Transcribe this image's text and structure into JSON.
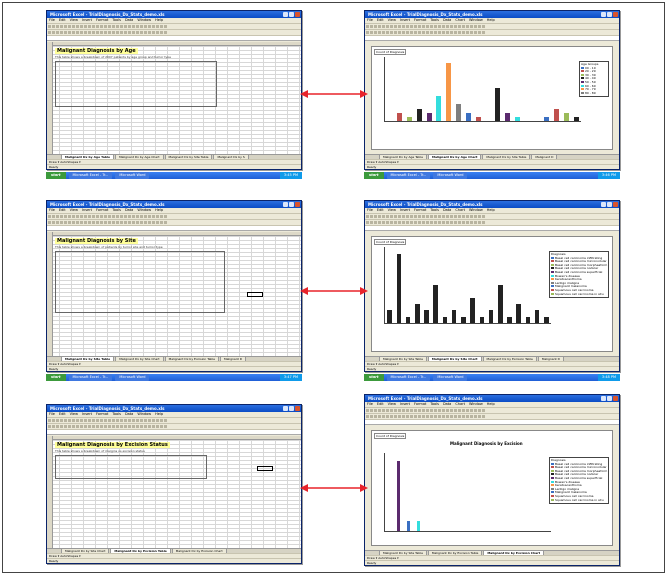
{
  "windows": [
    {
      "id": "age-table",
      "title": "Microsoft Excel - TrialDiagnosis_Dx_Stats_demo.xls",
      "menu": [
        "File",
        "Edit",
        "View",
        "Insert",
        "Format",
        "Tools",
        "Data",
        "Window",
        "Help"
      ],
      "sheet_title": "Malignant Diagnosis by Age",
      "sheet_subtitle": "This table shows a breakdown of 2007 patients by age group and tumor type",
      "tabs": [
        "Malignant Dx by Age Table",
        "Malignant Dx by Age Chart",
        "Malignant Dx by Site Table",
        "Malignant Dx by S"
      ],
      "active_tab": 0,
      "drawbar": "Draw ▾  AutoShapes ▾",
      "status": "Ready",
      "taskbar": {
        "start": "start",
        "tasks": [
          "Microsoft Excel - Tr...",
          "Microsoft Word"
        ],
        "clock": "3:45 PM"
      }
    },
    {
      "id": "age-chart",
      "title": "Microsoft Excel - TrialDiagnosis_Dx_Stats_demo.xls",
      "menu": [
        "File",
        "Edit",
        "View",
        "Insert",
        "Format",
        "Tools",
        "Data",
        "Chart",
        "Window",
        "Help"
      ],
      "chart_tag": "Count of Diagnosis",
      "legend_title": "Age Groups",
      "legend_items": [
        "00 - 19",
        "20 - 29",
        "30 - 39",
        "40 - 49",
        "50 - 59",
        "60 - 69",
        "70 - 79",
        "80 - 89"
      ],
      "tabs": [
        "Malignant Dx by Age Table",
        "Malignant Dx by Age Chart",
        "Malignant Dx by Site Table",
        "Malignant D"
      ],
      "active_tab": 1,
      "drawbar": "Draw ▾  AutoShapes ▾",
      "status": "Ready",
      "taskbar": {
        "start": "start",
        "tasks": [
          "Microsoft Excel - Tr...",
          "Microsoft Word"
        ],
        "clock": "3:46 PM"
      }
    },
    {
      "id": "site-table",
      "title": "Microsoft Excel - TrialDiagnosis_Dx_Stats_demo.xls",
      "menu": [
        "File",
        "Edit",
        "View",
        "Insert",
        "Format",
        "Tools",
        "Data",
        "Window",
        "Help"
      ],
      "sheet_title": "Malignant Diagnosis by Site",
      "sheet_subtitle": "This table shows a breakdown of patients by tumor site and tumor type",
      "tabs": [
        "Malignant Dx by Site Table",
        "Malignant Dx by Site Chart",
        "Malignant Dx by Excision Table",
        "Malignant D"
      ],
      "active_tab": 0,
      "drawbar": "Draw ▾  AutoShapes ▾",
      "status": "Ready",
      "taskbar": {
        "start": "start",
        "tasks": [
          "Microsoft Excel - Tr...",
          "Microsoft Word"
        ],
        "clock": "3:47 PM"
      }
    },
    {
      "id": "site-chart",
      "title": "Microsoft Excel - TrialDiagnosis_Dx_Stats_demo.xls",
      "menu": [
        "File",
        "Edit",
        "View",
        "Insert",
        "Format",
        "Tools",
        "Data",
        "Chart",
        "Window",
        "Help"
      ],
      "chart_tag": "Count of Diagnosis",
      "legend_title": "Diagnosis",
      "legend_items": [
        "Basal cell carcinoma infiltrating",
        "Basal cell carcinoma micronodular",
        "Basal cell carcinoma morpheaform",
        "Basal cell carcinoma nodular",
        "Basal cell carcinoma superficial",
        "Bowen's disease",
        "Keratoacanthoma",
        "Lentigo maligna",
        "Malignant melanoma",
        "Squamous cell carcinoma",
        "Squamous cell carcinoma in situ"
      ],
      "tabs": [
        "Malignant Dx by Site Table",
        "Malignant Dx by Site Chart",
        "Malignant Dx by Excision Table",
        "Malignant D"
      ],
      "active_tab": 1,
      "drawbar": "Draw ▾  AutoShapes ▾",
      "status": "Ready",
      "taskbar": {
        "start": "start",
        "tasks": [
          "Microsoft Excel - Tr...",
          "Microsoft Word"
        ],
        "clock": "3:48 PM"
      }
    },
    {
      "id": "excision-table",
      "title": "Microsoft Excel - TrialDiagnosis_Dx_Stats_demo.xls",
      "menu": [
        "File",
        "Edit",
        "View",
        "Insert",
        "Format",
        "Tools",
        "Data",
        "Window",
        "Help"
      ],
      "sheet_title": "Malignant Diagnosis by Excision Status",
      "sheet_subtitle": "This table shows a breakdown of margins vs excision status",
      "tabs": [
        "Malignant Dx by Site Chart",
        "Malignant Dx by Excision Table",
        "Malignant Dx by Excision Chart"
      ],
      "active_tab": 1,
      "drawbar": "Draw ▾  AutoShapes ▾",
      "status": "Ready",
      "taskbar": null
    },
    {
      "id": "excision-chart",
      "title": "Microsoft Excel - TrialDiagnosis_Dx_Stats_demo.xls",
      "menu": [
        "File",
        "Edit",
        "View",
        "Insert",
        "Format",
        "Tools",
        "Data",
        "Chart",
        "Window",
        "Help"
      ],
      "chart_title": "Malignant Diagnosis by Excision",
      "chart_tag": "Count of Diagnosis",
      "legend_title": "Diagnosis",
      "legend_items": [
        "Basal cell carcinoma infiltrating",
        "Basal cell carcinoma micronodular",
        "Basal cell carcinoma morpheaform",
        "Basal cell carcinoma nodular",
        "Basal cell carcinoma superficial",
        "Bowen's disease",
        "Keratoacanthoma",
        "Lentigo maligna",
        "Malignant melanoma",
        "Squamous cell carcinoma",
        "Squamous cell carcinoma in situ"
      ],
      "tabs": [
        "Malignant Dx by Site Table",
        "Malignant Dx by Excision Table",
        "Malignant Dx by Excision Chart"
      ],
      "active_tab": 2,
      "drawbar": "Draw ▾  AutoShapes ▾",
      "status": "Ready",
      "taskbar": null
    }
  ],
  "colors": {
    "arrow": "#e8232a",
    "title_fill": "#ffff99",
    "bar_purple": "#5b2a6e",
    "bar_cyan": "#33dddd",
    "bar_dark": "#222222",
    "bar_red": "#c0504d",
    "bar_blue": "#3a6fc2"
  },
  "icons": [
    "double-headed-arrow-icon",
    "close-icon",
    "minimize-icon",
    "maximize-icon",
    "start-flag-icon"
  ],
  "chart_data": [
    {
      "type": "bar",
      "title": "",
      "series_count": 8,
      "note_values_estimated": true,
      "values": [
        0,
        2,
        1,
        3,
        2,
        6,
        14,
        4,
        2,
        1,
        0,
        8,
        2,
        1,
        0,
        0,
        1,
        3,
        2,
        1
      ]
    },
    {
      "type": "bar",
      "title": "",
      "values": [
        2,
        11,
        1,
        3,
        2,
        6,
        1,
        2,
        1,
        4,
        1,
        2,
        6,
        1,
        3,
        1,
        2,
        1
      ]
    },
    {
      "type": "bar",
      "title": "Malignant Diagnosis by Excision",
      "ylim": [
        0,
        40
      ],
      "values": [
        36,
        5,
        5
      ]
    }
  ]
}
